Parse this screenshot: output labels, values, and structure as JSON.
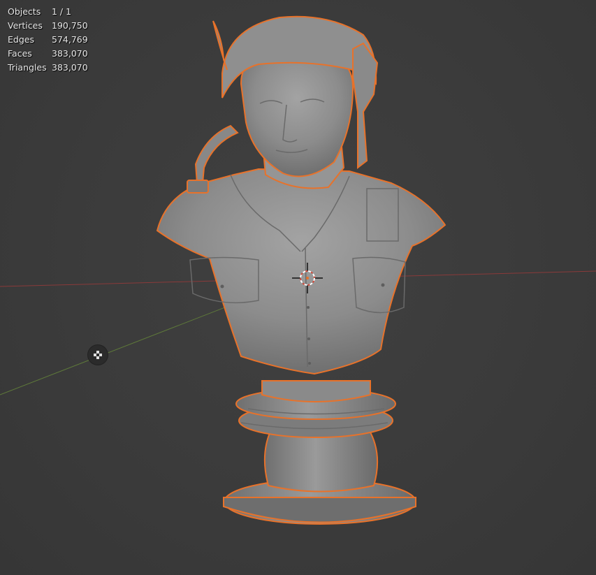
{
  "viewport": {
    "stats": [
      {
        "label": "Objects",
        "value": "1 / 1"
      },
      {
        "label": "Vertices",
        "value": "190,750"
      },
      {
        "label": "Edges",
        "value": "574,769"
      },
      {
        "label": "Faces",
        "value": "383,070"
      },
      {
        "label": "Triangles",
        "value": "383,070"
      }
    ],
    "icons": {
      "camera_gizmo": "camera-view-icon",
      "origin": "3d-cursor-icon"
    },
    "colors": {
      "background": "#3a3a3a",
      "selection_outline": "#e8722a",
      "x_axis": "#8a3a3a",
      "y_axis": "#5f7a3a",
      "mesh": "#8b8b8b",
      "text": "#e6e6e6"
    }
  }
}
